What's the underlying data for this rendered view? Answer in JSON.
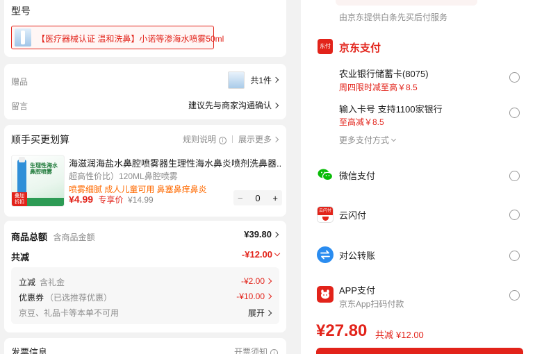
{
  "model_section": {
    "title": "型号",
    "selected_option": "【医疗器械认证 温和洗鼻】小诺等渗海水喷雾50ml"
  },
  "gift_row": {
    "label": "赠品",
    "count": "共1件"
  },
  "note_row": {
    "label": "留言",
    "value": "建议先与商家沟通确认"
  },
  "addon_section": {
    "title": "顺手买更划算",
    "rules_label": "规则说明",
    "more_label": "展示更多",
    "product": {
      "title": "海滋润海盐水鼻腔喷雾器生理性海水鼻炎喷剂洗鼻器...",
      "subtitle": "超高性价比）120ML鼻腔喷雾",
      "tags": "喷雾细腻 成人儿童可用 鼻塞鼻痒鼻炎",
      "price": "¥4.99",
      "price_note": "专享价",
      "original_price": "¥14.99",
      "minus": "−",
      "quantity": "0",
      "plus": "+",
      "image_badge_top": "生理性海水\n鼻腔喷雾",
      "image_badge_bottom": "叠加\n折扣"
    }
  },
  "summary": {
    "total_label": "商品总额",
    "total_sub": "含商品金额",
    "total_value": "¥39.80",
    "discount_label": "共减",
    "discount_value": "-¥12.00",
    "details": [
      {
        "label": "立减",
        "sub": "含礼金",
        "value": "-¥2.00"
      },
      {
        "label": "优惠券",
        "sub": "（已选推荐优惠）",
        "value": "-¥10.00"
      }
    ],
    "jd_bean_note": "京豆、礼品卡等本单不可用",
    "expand_label": "展开"
  },
  "invoice": {
    "title": "发票信息",
    "notice": "开票须知"
  },
  "payment": {
    "top_note": "由京东提供白条先买后付服务",
    "jd_pay_title": "京东支付",
    "jd_pay_icon_text": "东付",
    "options": [
      {
        "title": "农业银行储蓄卡(8075)",
        "promo": "周四限时减至高￥8.5"
      },
      {
        "title": "输入卡号 支持1100家银行",
        "promo": "至高减￥8.5"
      }
    ],
    "more_methods": "更多支付方式",
    "methods": [
      {
        "name": "微信支付",
        "icon": "wechat-pay-icon"
      },
      {
        "name": "云闪付",
        "icon": "unionpay-quickpass-icon",
        "icon_text": "云闪付"
      },
      {
        "name": "对公转账",
        "icon": "transfer-icon"
      },
      {
        "name": "APP支付",
        "sub": "京东App扫码付款",
        "icon": "jd-app-icon"
      }
    ],
    "final_price": "¥27.80",
    "final_discount_label": "共减",
    "final_discount_value": "¥12.00"
  },
  "colors": {
    "accent_red": "#e2231a",
    "orange": "#ff6a00",
    "wechat_green": "#09bb07",
    "transfer_blue": "#2a8cf0"
  }
}
